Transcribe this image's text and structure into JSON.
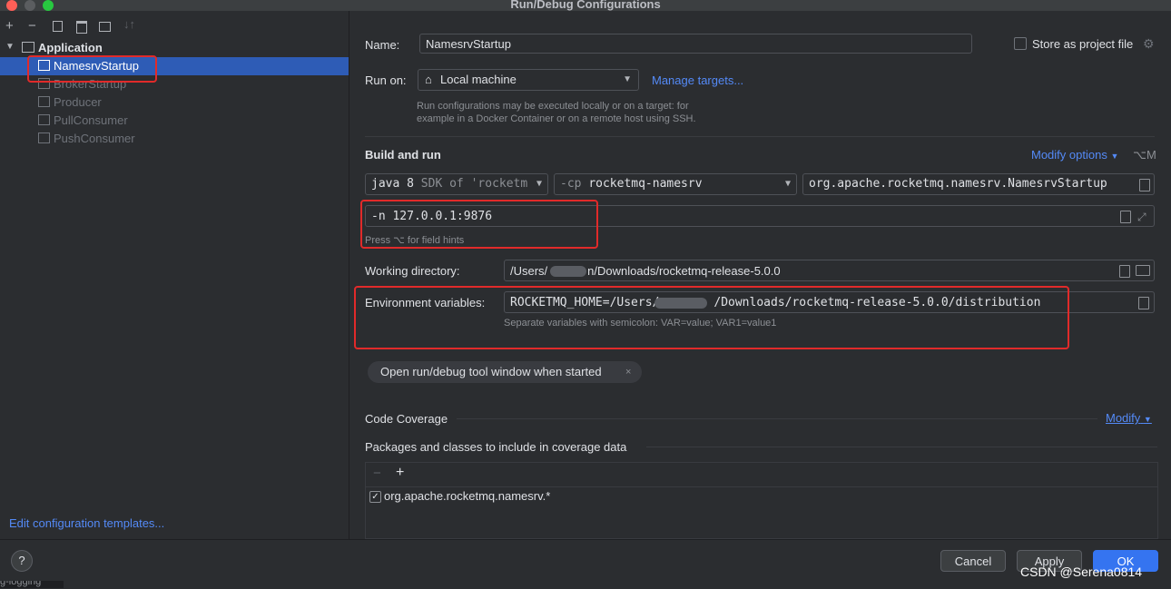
{
  "window": {
    "title": "Run/Debug Configurations"
  },
  "sidebar": {
    "group_label": "Application",
    "items": [
      {
        "label": "NamesrvStartup"
      },
      {
        "label": "BrokerStartup"
      },
      {
        "label": "Producer"
      },
      {
        "label": "PullConsumer"
      },
      {
        "label": "PushConsumer"
      }
    ],
    "edit_templates": "Edit configuration templates...",
    "help": "?"
  },
  "form": {
    "name_label": "Name:",
    "name_value": "NamesrvStartup",
    "store_label": "Store as project file",
    "run_on_label": "Run on:",
    "run_on_value": "Local machine",
    "manage_targets": "Manage targets...",
    "run_on_hint1": "Run configurations may be executed locally or on a target: for",
    "run_on_hint2": "example in a Docker Container or on a remote host using SSH.",
    "build_run_title": "Build and run",
    "modify_options": "Modify options",
    "modify_shortcut": "⌥M",
    "sdk_java": "java 8",
    "sdk_rest": "SDK of 'rocketm",
    "cp_flag": "-cp",
    "cp_value": "rocketmq-namesrv",
    "main_class": "org.apache.rocketmq.namesrv.NamesrvStartup",
    "program_args": "-n 127.0.0.1:9876",
    "field_hint": "Press ⌥ for field hints",
    "workdir_label": "Working directory:",
    "workdir_prefix": "/Users/",
    "workdir_suffix": "n/Downloads/rocketmq-release-5.0.0",
    "env_label": "Environment variables:",
    "env_prefix": "ROCKETMQ_HOME=/Users/",
    "env_suffix": "/Downloads/rocketmq-release-5.0.0/distribution",
    "env_hint": "Separate variables with semicolon: VAR=value; VAR1=value1",
    "open_tool_window": "Open run/debug tool window when started",
    "code_coverage": "Code Coverage",
    "modify": "Modify",
    "packages_title": "Packages and classes to include in coverage data",
    "package_entry": "org.apache.rocketmq.namesrv.*"
  },
  "buttons": {
    "cancel": "Cancel",
    "apply": "Apply",
    "ok": "OK"
  },
  "watermark": "CSDN @Serena0814",
  "bottom_fragment": "g-logging"
}
